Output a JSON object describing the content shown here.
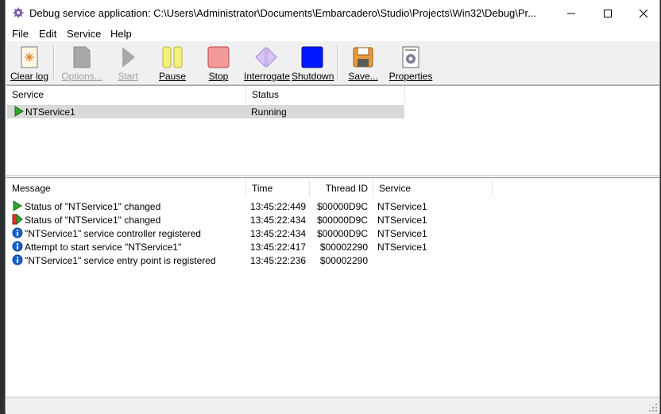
{
  "window": {
    "title": "Debug service application: C:\\Users\\Administrator\\Documents\\Embarcadero\\Studio\\Projects\\Win32\\Debug\\Pr...",
    "minimize_icon": "minimize-icon",
    "maximize_icon": "maximize-icon",
    "close_icon": "close-icon"
  },
  "menu": {
    "file": "File",
    "edit": "Edit",
    "service": "Service",
    "help": "Help"
  },
  "toolbar": {
    "clear_log": "Clear log",
    "options": "Options...",
    "start": "Start",
    "pause": "Pause",
    "stop": "Stop",
    "interrogate": "Interrogate",
    "shutdown": "Shutdown",
    "save": "Save...",
    "properties": "Properties"
  },
  "services": {
    "headers": {
      "service": "Service",
      "status": "Status"
    },
    "rows": [
      {
        "service": "NTService1",
        "status": "Running",
        "icon": "running-arrow-icon"
      }
    ]
  },
  "log": {
    "headers": {
      "message": "Message",
      "time": "Time",
      "thread_id": "Thread ID",
      "service": "Service"
    },
    "rows": [
      {
        "message": "Status of \"NTService1\" changed",
        "time": "13:45:22:449",
        "thread_id": "$00000D9C",
        "service": "NTService1",
        "icon": "running-arrow-icon"
      },
      {
        "message": "Status of \"NTService1\" changed",
        "time": "13:45:22:434",
        "thread_id": "$00000D9C",
        "service": "NTService1",
        "icon": "start-pending-icon"
      },
      {
        "message": "\"NTService1\" service controller registered",
        "time": "13:45:22:434",
        "thread_id": "$00000D9C",
        "service": "NTService1",
        "icon": "info-icon"
      },
      {
        "message": "Attempt to start service \"NTService1\"",
        "time": "13:45:22:417",
        "thread_id": "$00002290",
        "service": "NTService1",
        "icon": "info-icon"
      },
      {
        "message": "\"NTService1\" service entry point is registered",
        "time": "13:45:22:236",
        "thread_id": "$00002290",
        "service": "",
        "icon": "info-icon"
      }
    ]
  },
  "colors": {
    "running_green": "#2fa52f",
    "info_blue": "#1560d0",
    "pause_yellow": "#f5f07a",
    "stop_red": "#f28a8a",
    "shutdown_blue": "#0018ff",
    "interrogate_purple": "#c7a8f0"
  }
}
